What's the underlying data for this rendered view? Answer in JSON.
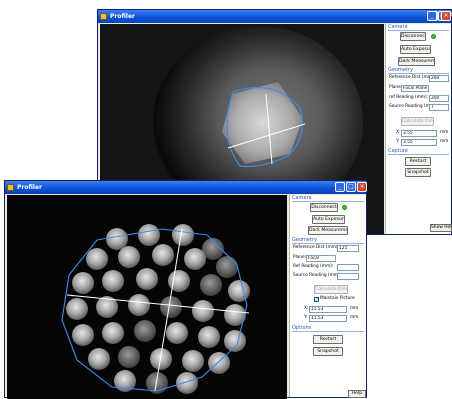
{
  "back_window": {
    "title": "Profiler",
    "camera_section": "Camera",
    "disconnect_label": "Disconnect",
    "auto_exposure_label": "Auto Exposure",
    "dark_measurement_label": "Dark Measurement",
    "geometry_section": "Geometry",
    "reference_dist_label": "Reference Dist (mm):",
    "reference_dist_value": "200",
    "plane_label": "Plane:",
    "plane_value": "Focal Plane",
    "ref_reading_label": "ref Reading (mm):",
    "ref_reading_value": "200",
    "source_reading_label": "Source Reading (mm):",
    "source_reading_value": "7",
    "calculate_label": "Calculate Dim.",
    "x_label": "X:",
    "x_value": "3.55",
    "x_unit": "mm",
    "y_label": "Y:",
    "y_value": "3.55",
    "y_unit": "mm",
    "capture_section": "Capture",
    "restart_label": "Restart",
    "snapshot_label": "Snapshot",
    "bottom_button_label": "Show Help",
    "controls": {
      "minimize": "_",
      "maximize": "□",
      "close": "×"
    }
  },
  "front_window": {
    "title": "Profiler",
    "camera_section": "Camera",
    "disconnect_label": "Disconnect",
    "auto_exposure_label": "Auto Exposure",
    "dark_measurement_label": "Dark Measurement",
    "geometry_section": "Geometry",
    "reference_dist_label": "Reference Dist (mm):",
    "reference_dist_value": "125",
    "plane_label": "Plane:",
    "plane_value": "Focal",
    "ref_reading_label": "Ref Reading (mm):",
    "ref_reading_value": "",
    "source_reading_label": "Source Reading (mm):",
    "source_reading_value": "",
    "calculate_label": "Calculate Dim.",
    "maintain_label": "Maintain Picture",
    "maintain_checked": true,
    "x_label": "X:",
    "x_value": "11.53",
    "x_unit": "mm",
    "y_label": "Y:",
    "y_value": "11.53",
    "y_unit": "mm",
    "options_section": "Options",
    "restart_label": "Restart",
    "snapshot_label": "Snapshot",
    "bottom_button_label": "Help",
    "controls": {
      "minimize": "_",
      "maximize": "□",
      "close": "×"
    }
  },
  "colors": {
    "accent": "#2a55c8",
    "led_on": "#2ecf2e",
    "close_button": "#d8452a"
  }
}
